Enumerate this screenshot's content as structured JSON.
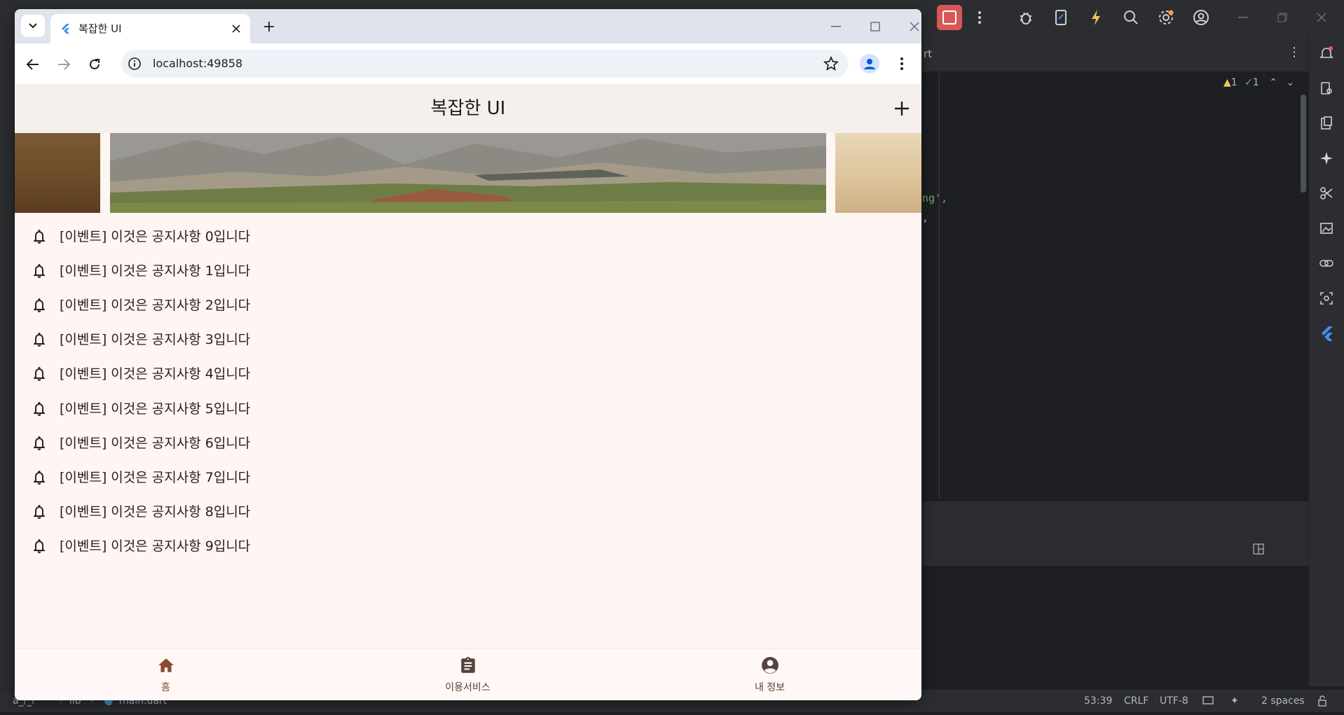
{
  "ide": {
    "tab_fragment": "rt",
    "warnings": "1",
    "checks": "1",
    "code_lines": [
      "ng',",
      ","
    ],
    "status": {
      "project": "a_/_l",
      "folder": "lib",
      "file": "main.dart",
      "position": "53:39",
      "line_sep": "CRLF",
      "encoding": "UTF-8",
      "indent": "2 spaces"
    },
    "colors": {
      "stop": "#d85858",
      "background": "#1e1f22",
      "chrome": "#2b2d30"
    }
  },
  "browser": {
    "tab_title": "복잡한 UI",
    "url": "localhost:49858"
  },
  "app": {
    "title": "복잡한 UI",
    "carousel": {
      "slides": [
        "brown-wood",
        "mountain-valley",
        "desert-sand"
      ]
    },
    "notices": [
      "[이벤트] 이것은 공지사항 0입니다",
      "[이벤트] 이것은 공지사항 1입니다",
      "[이벤트] 이것은 공지사항 2입니다",
      "[이벤트] 이것은 공지사항 3입니다",
      "[이벤트] 이것은 공지사항 4입니다",
      "[이벤트] 이것은 공지사항 5입니다",
      "[이벤트] 이것은 공지사항 6입니다",
      "[이벤트] 이것은 공지사항 7입니다",
      "[이벤트] 이것은 공지사항 8입니다",
      "[이벤트] 이것은 공지사항 9입니다"
    ],
    "bottom_nav": [
      {
        "label": "홈",
        "icon": "home-icon",
        "active": true
      },
      {
        "label": "이용서비스",
        "icon": "clipboard-icon",
        "active": false
      },
      {
        "label": "내 정보",
        "icon": "account-circle-icon",
        "active": false
      }
    ],
    "colors": {
      "primary": "#8b4a31",
      "inactive": "#56433d",
      "background": "#fff5f2",
      "appbar": "#f5f0ee"
    }
  }
}
